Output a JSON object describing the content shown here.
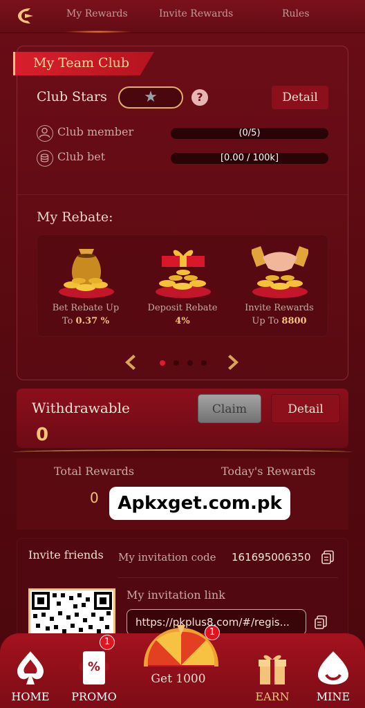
{
  "topnav": {
    "tabs": [
      "My Rewards",
      "Invite Rewards",
      "Rules"
    ],
    "active_tab": "My Rewards"
  },
  "club": {
    "title": "My Team Club",
    "stars_label": "Club Stars",
    "help_symbol": "?",
    "detail_label": "Detail",
    "member_label": "Club member",
    "member_progress": "(0/5)",
    "bet_label": "Club bet",
    "bet_progress": "[0.00 / 100k]"
  },
  "rebate": {
    "title": "My Rebate:",
    "items": [
      {
        "line1": "Bet Rebate Up",
        "line2_prefix": "To ",
        "line2_value": "0.37 %",
        "icon": "money-bag-icon"
      },
      {
        "line1": "Deposit Rebate",
        "line2_prefix": "",
        "line2_value": "4%",
        "icon": "gift-box-icon"
      },
      {
        "line1": "Invite Rewards",
        "line2_prefix": "Up To ",
        "line2_value": "8800",
        "icon": "handshake-icon"
      }
    ],
    "page_dots": 4,
    "active_dot": 0
  },
  "withdraw": {
    "label": "Withdrawable",
    "value": "0",
    "claim_label": "Claim",
    "detail_label": "Detail"
  },
  "rewards": {
    "total_label": "Total Rewards",
    "today_label": "Today's Rewards",
    "total_value": "0"
  },
  "watermark": "Apkxget.com.pk",
  "invite": {
    "title": "Invite friends",
    "code_label": "My invitation code",
    "code_value": "161695006350",
    "link_label": "My invitation link",
    "link_value": "https://pkplus8.com/#/regis..."
  },
  "bottomnav": {
    "home": "HOME",
    "promo": "PROMO",
    "promo_badge": "1",
    "get": "Get 1000",
    "get_badge": "1",
    "earn": "EARN",
    "mine": "MINE"
  },
  "colors": {
    "background": "#5a0a12",
    "accent_gold": "#f3c37a",
    "accent_red": "#d81f2c",
    "badge_red": "#e0141f"
  }
}
